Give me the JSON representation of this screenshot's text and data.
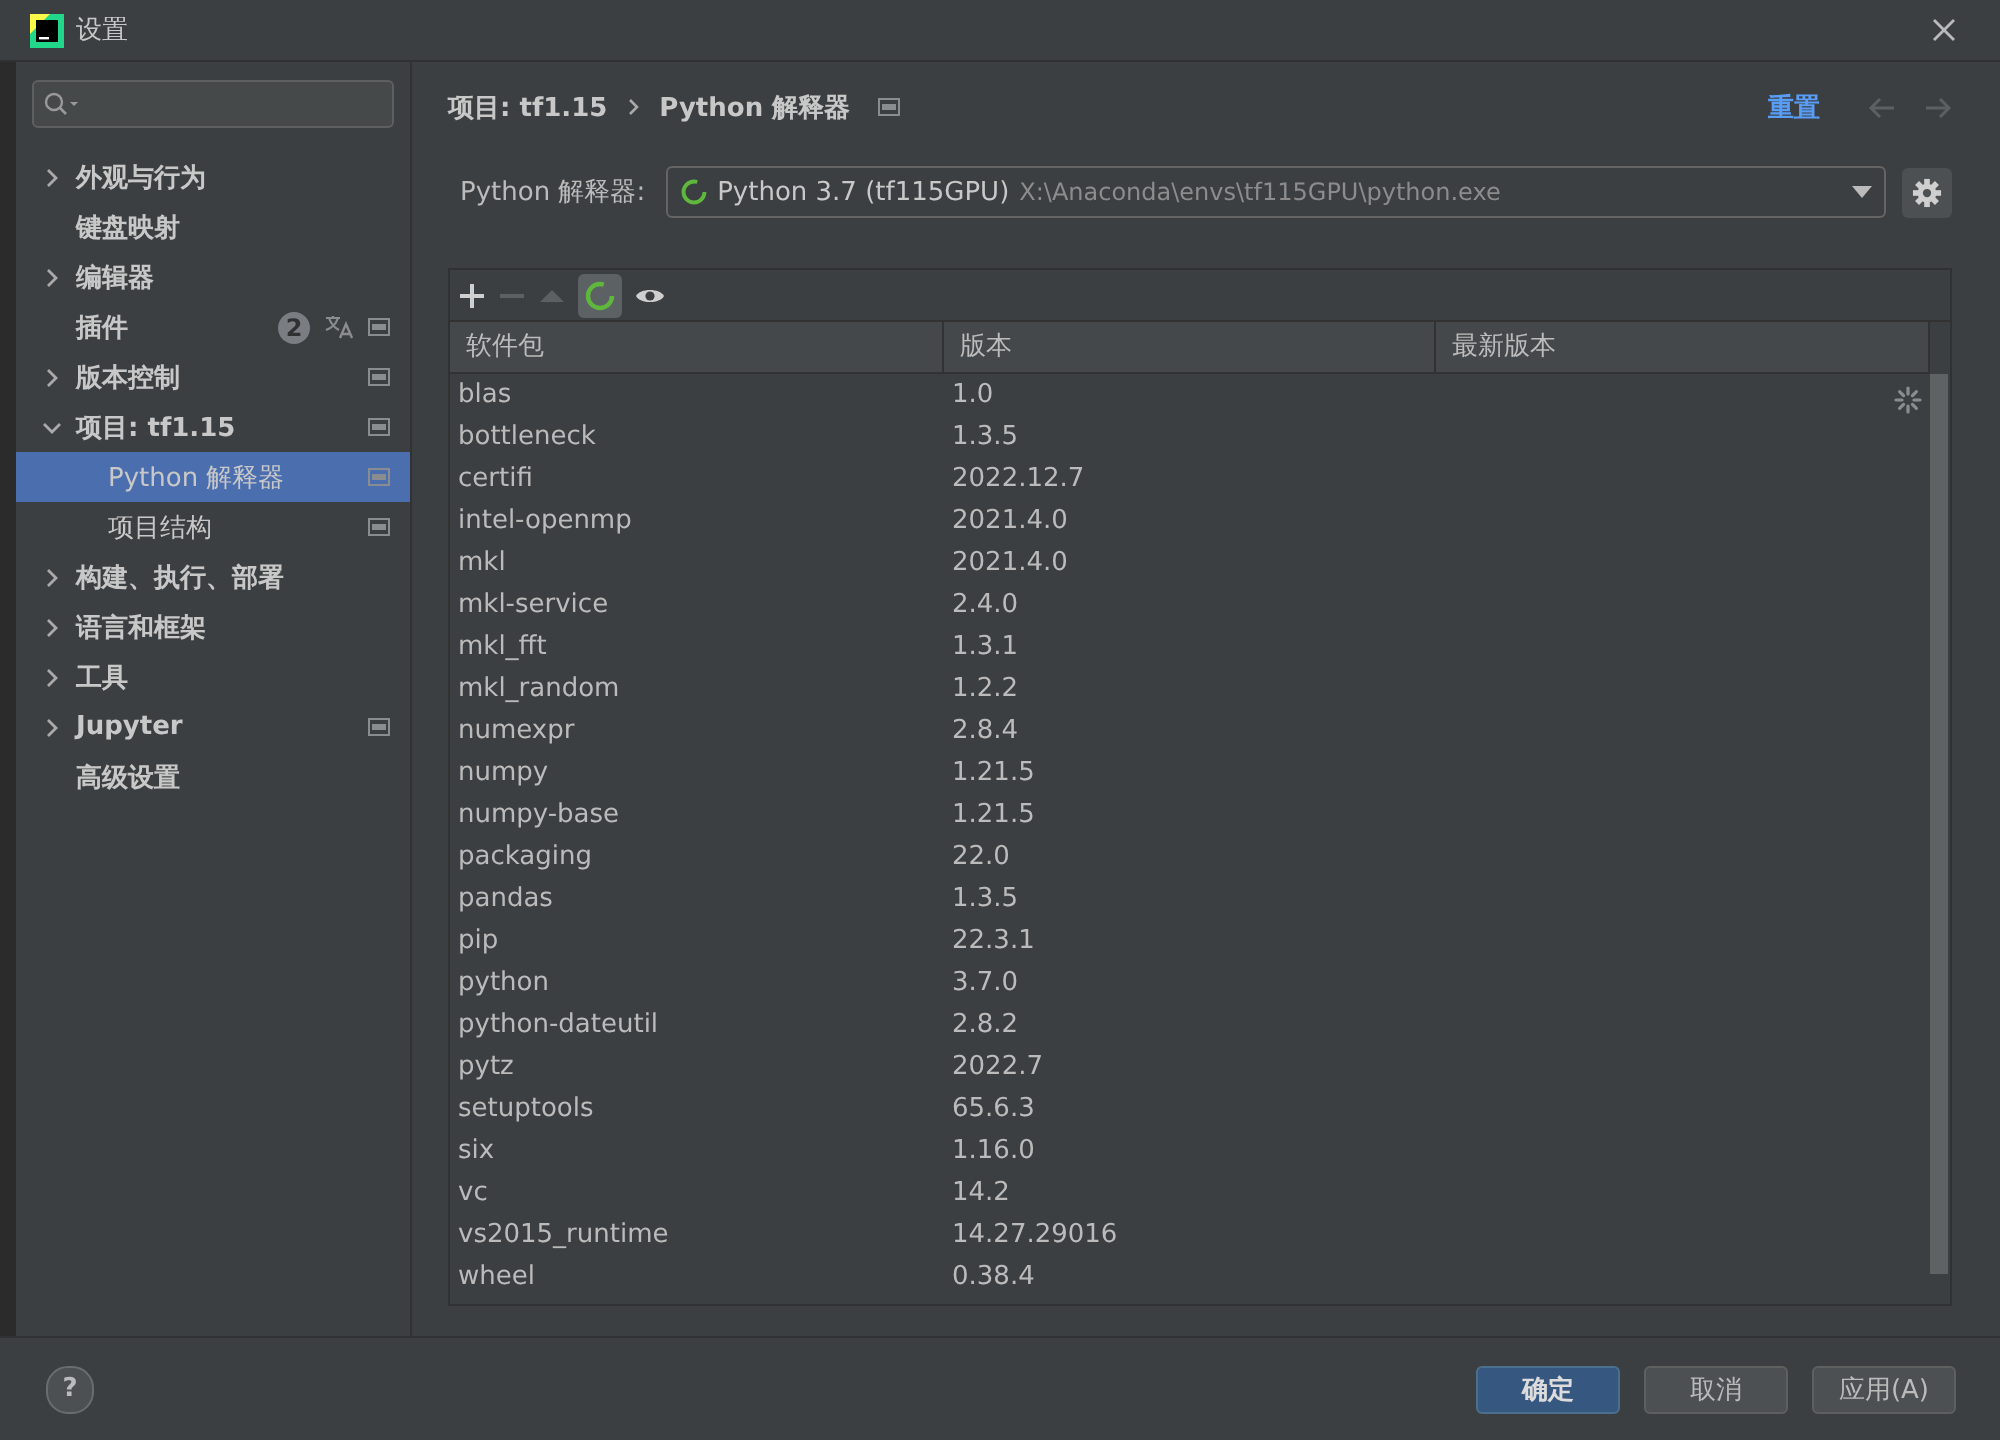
{
  "window": {
    "title": "设置"
  },
  "sidebar": {
    "items": [
      {
        "label": "外观与行为",
        "kind": "group",
        "expanded": false,
        "selected": false,
        "project_level": false
      },
      {
        "label": "键盘映射",
        "kind": "page",
        "selected": false,
        "project_level": false
      },
      {
        "label": "编辑器",
        "kind": "group",
        "expanded": false,
        "selected": false,
        "project_level": false
      },
      {
        "label": "插件",
        "kind": "page",
        "selected": false,
        "project_level": true,
        "badge": "2",
        "translatable": true
      },
      {
        "label": "版本控制",
        "kind": "group",
        "expanded": false,
        "selected": false,
        "project_level": true
      },
      {
        "label": "项目: tf1.15",
        "kind": "group",
        "expanded": true,
        "selected": false,
        "project_level": true,
        "children": [
          {
            "label": "Python 解释器",
            "kind": "page",
            "selected": true,
            "project_level": true
          },
          {
            "label": "项目结构",
            "kind": "page",
            "selected": false,
            "project_level": true
          }
        ]
      },
      {
        "label": "构建、执行、部署",
        "kind": "group",
        "expanded": false,
        "selected": false,
        "project_level": false
      },
      {
        "label": "语言和框架",
        "kind": "group",
        "expanded": false,
        "selected": false,
        "project_level": false
      },
      {
        "label": "工具",
        "kind": "group",
        "expanded": false,
        "selected": false,
        "project_level": false
      },
      {
        "label": "Jupyter",
        "kind": "group",
        "expanded": false,
        "selected": false,
        "project_level": true
      },
      {
        "label": "高级设置",
        "kind": "page",
        "selected": false,
        "project_level": false
      }
    ]
  },
  "breadcrumb": [
    "项目: tf1.15",
    "Python 解释器"
  ],
  "reset_link": "重置",
  "interpreter": {
    "label": "Python 解释器:",
    "name": "Python 3.7 (tf115GPU)",
    "path": "X:\\Anaconda\\envs\\tf115GPU\\python.exe"
  },
  "table": {
    "columns": [
      "软件包",
      "版本",
      "最新版本"
    ],
    "rows": [
      [
        "blas",
        "1.0"
      ],
      [
        "bottleneck",
        "1.3.5"
      ],
      [
        "certifi",
        "2022.12.7"
      ],
      [
        "intel-openmp",
        "2021.4.0"
      ],
      [
        "mkl",
        "2021.4.0"
      ],
      [
        "mkl-service",
        "2.4.0"
      ],
      [
        "mkl_fft",
        "1.3.1"
      ],
      [
        "mkl_random",
        "1.2.2"
      ],
      [
        "numexpr",
        "2.8.4"
      ],
      [
        "numpy",
        "1.21.5"
      ],
      [
        "numpy-base",
        "1.21.5"
      ],
      [
        "packaging",
        "22.0"
      ],
      [
        "pandas",
        "1.3.5"
      ],
      [
        "pip",
        "22.3.1"
      ],
      [
        "python",
        "3.7.0"
      ],
      [
        "python-dateutil",
        "2.8.2"
      ],
      [
        "pytz",
        "2022.7"
      ],
      [
        "setuptools",
        "65.6.3"
      ],
      [
        "six",
        "1.16.0"
      ],
      [
        "vc",
        "14.2"
      ],
      [
        "vs2015_runtime",
        "14.27.29016"
      ],
      [
        "wheel",
        "0.38.4"
      ]
    ]
  },
  "help": "?",
  "buttons": [
    {
      "label": "确定",
      "kind": "primary"
    },
    {
      "label": "取消",
      "kind": "normal"
    },
    {
      "label": "应用(A)",
      "kind": "normal"
    }
  ]
}
